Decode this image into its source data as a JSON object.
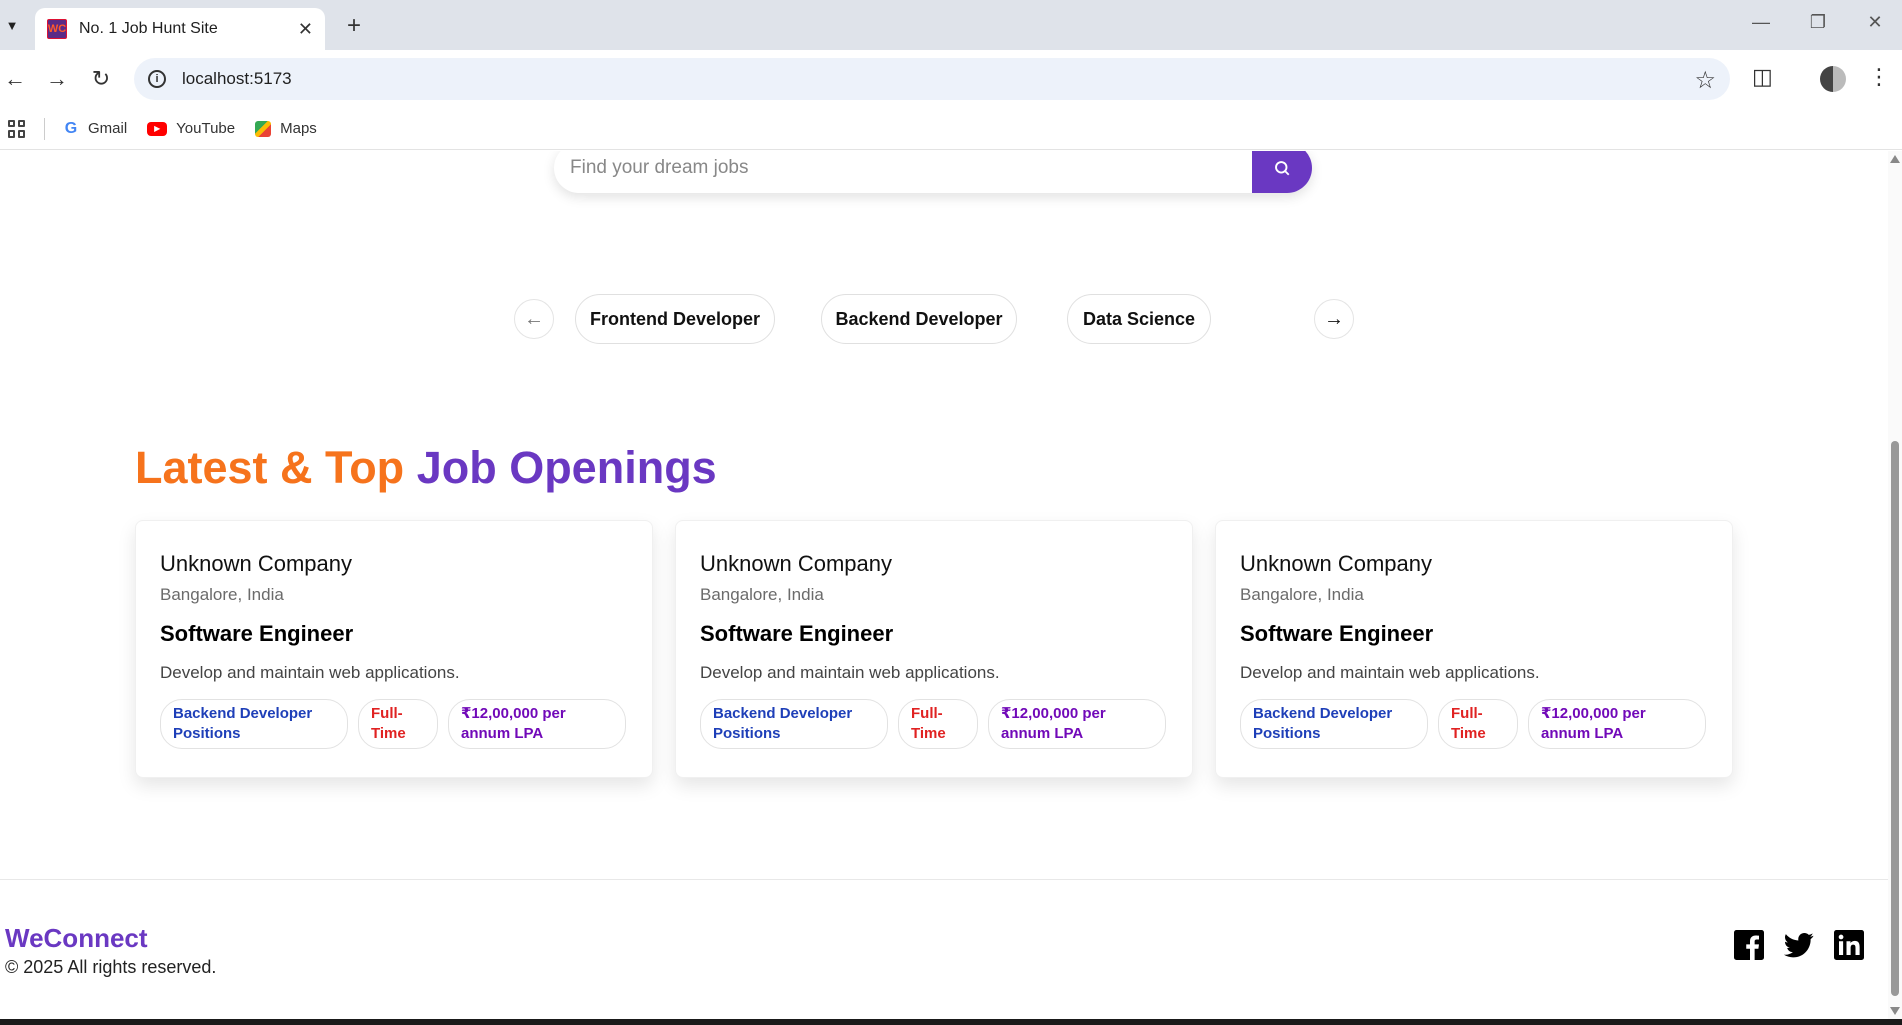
{
  "browser": {
    "tab_title": "No. 1 Job Hunt Site",
    "favicon_text": "WC",
    "url": "localhost:5173",
    "bookmarks": [
      {
        "label": "Gmail",
        "icon": "gmail-icon"
      },
      {
        "label": "YouTube",
        "icon": "youtube-icon"
      },
      {
        "label": "Maps",
        "icon": "maps-icon"
      }
    ]
  },
  "search": {
    "placeholder": "Find your dream jobs",
    "button_icon": "search-icon"
  },
  "categories": {
    "items": [
      "Frontend Developer",
      "Backend Developer",
      "Data Science"
    ],
    "prev_icon": "arrow-left-icon",
    "next_icon": "arrow-right-icon"
  },
  "section": {
    "heading_part1": "Latest & Top",
    "heading_part2": "Job Openings"
  },
  "jobs": [
    {
      "company": "Unknown Company",
      "location": "Bangalore, India",
      "title": "Software Engineer",
      "description": "Develop and maintain web applications.",
      "position": "Backend Developer Positions",
      "type": "Full-Time",
      "salary": "₹12,00,000 per annum LPA"
    },
    {
      "company": "Unknown Company",
      "location": "Bangalore, India",
      "title": "Software Engineer",
      "description": "Develop and maintain web applications.",
      "position": "Backend Developer Positions",
      "type": "Full-Time",
      "salary": "₹12,00,000 per annum LPA"
    },
    {
      "company": "Unknown Company",
      "location": "Bangalore, India",
      "title": "Software Engineer",
      "description": "Develop and maintain web applications.",
      "position": "Backend Developer Positions",
      "type": "Full-Time",
      "salary": "₹12,00,000 per annum LPA"
    }
  ],
  "footer": {
    "brand": "WeConnect",
    "copyright": "© 2025 All rights reserved.",
    "social": [
      "facebook-icon",
      "twitter-icon",
      "linkedin-icon"
    ]
  },
  "colors": {
    "accent_purple": "#6a38c2",
    "accent_orange": "#f6731c",
    "badge_blue": "#1e3fb8",
    "badge_red": "#e02222",
    "badge_purple": "#7109b8"
  }
}
